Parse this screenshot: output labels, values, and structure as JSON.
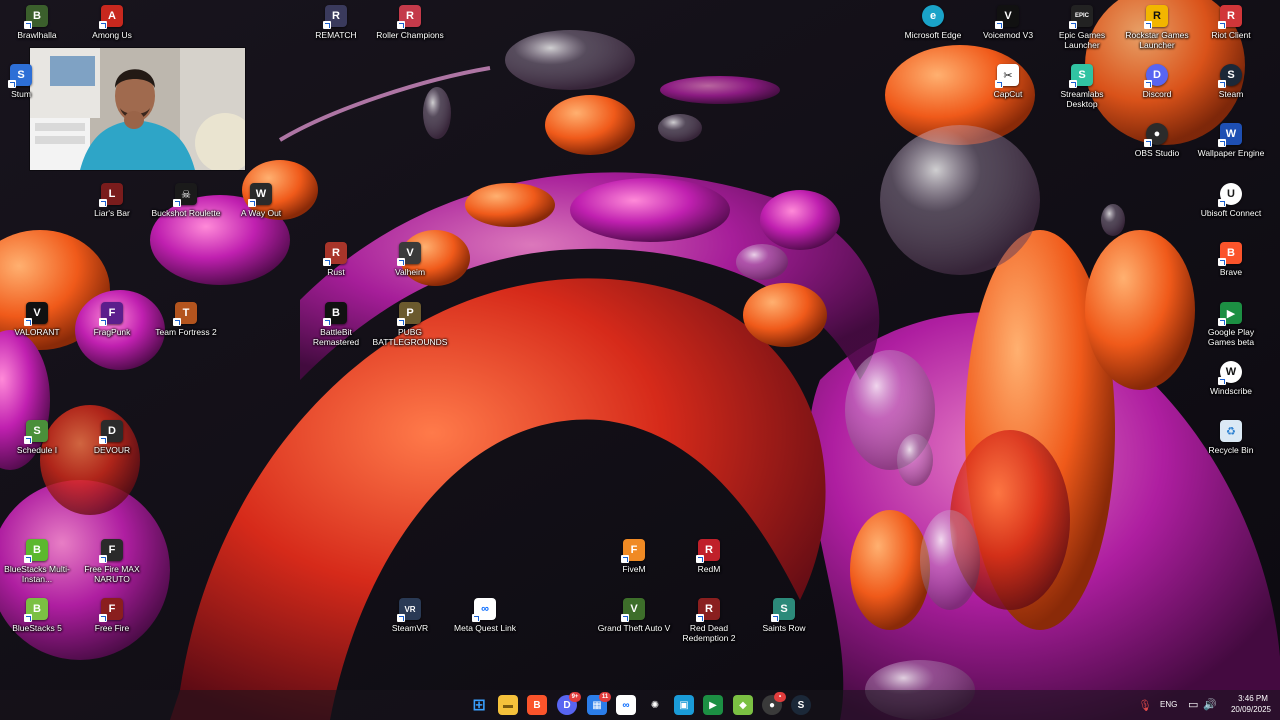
{
  "desktop_icons": [
    {
      "id": "brawlhalla",
      "label": "Brawlhalla",
      "color": "#3b5f2c",
      "glyph": "B"
    },
    {
      "id": "among-us",
      "label": "Among Us",
      "color": "#c8281e",
      "glyph": "A"
    },
    {
      "id": "stumble",
      "label": "Stum",
      "color": "#2d6fd6",
      "glyph": "S"
    },
    {
      "id": "liars-bar",
      "label": "Liar's Bar",
      "color": "#7a1c1c",
      "glyph": "L"
    },
    {
      "id": "buckshot-roulette",
      "label": "Buckshot Roulette",
      "color": "#1a1a1a",
      "glyph": "☠"
    },
    {
      "id": "a-way-out",
      "label": "A Way Out",
      "color": "#2a2a2a",
      "glyph": "W"
    },
    {
      "id": "valorant",
      "label": "VALORANT",
      "color": "#111111",
      "glyph": "V"
    },
    {
      "id": "fragpunk",
      "label": "FragPunk",
      "color": "#5b1e8c",
      "glyph": "F"
    },
    {
      "id": "team-fortress-2",
      "label": "Team Fortress 2",
      "color": "#b3541e",
      "glyph": "T"
    },
    {
      "id": "schedule-i",
      "label": "Schedule I",
      "color": "#4a8f3a",
      "glyph": "S"
    },
    {
      "id": "devour",
      "label": "DEVOUR",
      "color": "#2b2b2b",
      "glyph": "D"
    },
    {
      "id": "bluestacks-multi",
      "label": "BlueStacks Multi-Instan...",
      "color": "#5cb82e",
      "glyph": "B"
    },
    {
      "id": "free-fire-max-naruto",
      "label": "Free Fire MAX NARUTO",
      "color": "#2a2a2a",
      "glyph": "F"
    },
    {
      "id": "bluestacks-5",
      "label": "BlueStacks 5",
      "color": "#7bc043",
      "glyph": "B"
    },
    {
      "id": "free-fire",
      "label": "Free Fire",
      "color": "#8a1e1e",
      "glyph": "F"
    },
    {
      "id": "rematch",
      "label": "REMATCH",
      "color": "#3a3a5c",
      "glyph": "R"
    },
    {
      "id": "roller-champions",
      "label": "Roller Champions",
      "color": "#c43a4a",
      "glyph": "R"
    },
    {
      "id": "rust",
      "label": "Rust",
      "color": "#a8352a",
      "glyph": "R"
    },
    {
      "id": "valheim",
      "label": "Valheim",
      "color": "#3a3a3a",
      "glyph": "V"
    },
    {
      "id": "battlebit",
      "label": "BattleBit Remastered",
      "color": "#111111",
      "glyph": "B"
    },
    {
      "id": "pubg",
      "label": "PUBG BATTLEGROUNDS",
      "color": "#6b5a2e",
      "glyph": "P"
    },
    {
      "id": "steamvr",
      "label": "SteamVR",
      "color": "#2a3a55",
      "glyph": "VR"
    },
    {
      "id": "meta-quest-link",
      "label": "Meta Quest Link",
      "color": "#ffffff",
      "glyph": "∞"
    },
    {
      "id": "fivem",
      "label": "FiveM",
      "color": "#f08a24",
      "glyph": "F"
    },
    {
      "id": "redm",
      "label": "RedM",
      "color": "#c0202a",
      "glyph": "R"
    },
    {
      "id": "gta-v",
      "label": "Grand Theft Auto V",
      "color": "#3d6e2a",
      "glyph": "V"
    },
    {
      "id": "rdr2",
      "label": "Red Dead Redemption 2",
      "color": "#8a1f1f",
      "glyph": "R"
    },
    {
      "id": "saints-row",
      "label": "Saints Row",
      "color": "#2c8a7a",
      "glyph": "S"
    },
    {
      "id": "microsoft-edge",
      "label": "Microsoft Edge",
      "color": "#1aa3c8",
      "glyph": "e"
    },
    {
      "id": "voicemod",
      "label": "Voicemod V3",
      "color": "#111111",
      "glyph": "V"
    },
    {
      "id": "epic-games",
      "label": "Epic Games Launcher",
      "color": "#222222",
      "glyph": "EPIC"
    },
    {
      "id": "rockstar",
      "label": "Rockstar Games Launcher",
      "color": "#f2b600",
      "glyph": "R"
    },
    {
      "id": "riot-client",
      "label": "Riot Client",
      "color": "#d13639",
      "glyph": "R"
    },
    {
      "id": "capcut",
      "label": "CapCut",
      "color": "#ffffff",
      "glyph": "✂"
    },
    {
      "id": "streamlabs",
      "label": "Streamlabs Desktop",
      "color": "#31c3a2",
      "glyph": "S"
    },
    {
      "id": "discord",
      "label": "Discord",
      "color": "#5865f2",
      "glyph": "D"
    },
    {
      "id": "steam",
      "label": "Steam",
      "color": "#1b2838",
      "glyph": "S"
    },
    {
      "id": "obs",
      "label": "OBS Studio",
      "color": "#2b2b2b",
      "glyph": "●"
    },
    {
      "id": "wallpaper-engine",
      "label": "Wallpaper Engine",
      "color": "#1e4fb3",
      "glyph": "W"
    },
    {
      "id": "ubisoft-connect",
      "label": "Ubisoft Connect",
      "color": "#ffffff",
      "glyph": "U"
    },
    {
      "id": "brave",
      "label": "Brave",
      "color": "#fb542b",
      "glyph": "B"
    },
    {
      "id": "google-play-games",
      "label": "Google Play Games beta",
      "color": "#1c8f43",
      "glyph": "▶"
    },
    {
      "id": "windscribe",
      "label": "Windscribe",
      "color": "#ffffff",
      "glyph": "W"
    },
    {
      "id": "recycle-bin",
      "label": "Recycle Bin",
      "color": "#dbe9f5",
      "glyph": "♻"
    }
  ],
  "taskbar": {
    "apps": [
      {
        "id": "start",
        "glyph": "⊞",
        "color": "#3aa0ff"
      },
      {
        "id": "file-explorer",
        "glyph": "▬",
        "color": "#f5c13b"
      },
      {
        "id": "brave",
        "glyph": "B",
        "color": "#fb542b"
      },
      {
        "id": "discord",
        "glyph": "D",
        "color": "#5865f2",
        "badge": "9+"
      },
      {
        "id": "store",
        "glyph": "▦",
        "color": "#2b7de9",
        "badge": "11"
      },
      {
        "id": "meta",
        "glyph": "∞",
        "color": "#0a6cff"
      },
      {
        "id": "chatgpt",
        "glyph": "✺",
        "color": "#2e2e2e"
      },
      {
        "id": "photos",
        "glyph": "▣",
        "color": "#1a9bd7"
      },
      {
        "id": "google-play-games",
        "glyph": "▶",
        "color": "#1c8f43"
      },
      {
        "id": "bluestacks",
        "glyph": "◆",
        "color": "#7bc043"
      },
      {
        "id": "obs",
        "glyph": "●",
        "color": "#3a3a3a",
        "badge": "•"
      },
      {
        "id": "steam",
        "glyph": "S",
        "color": "#1b2838"
      }
    ],
    "tray": {
      "language": "ENG",
      "time": "3:46 PM",
      "date": "20/09/2025"
    }
  }
}
